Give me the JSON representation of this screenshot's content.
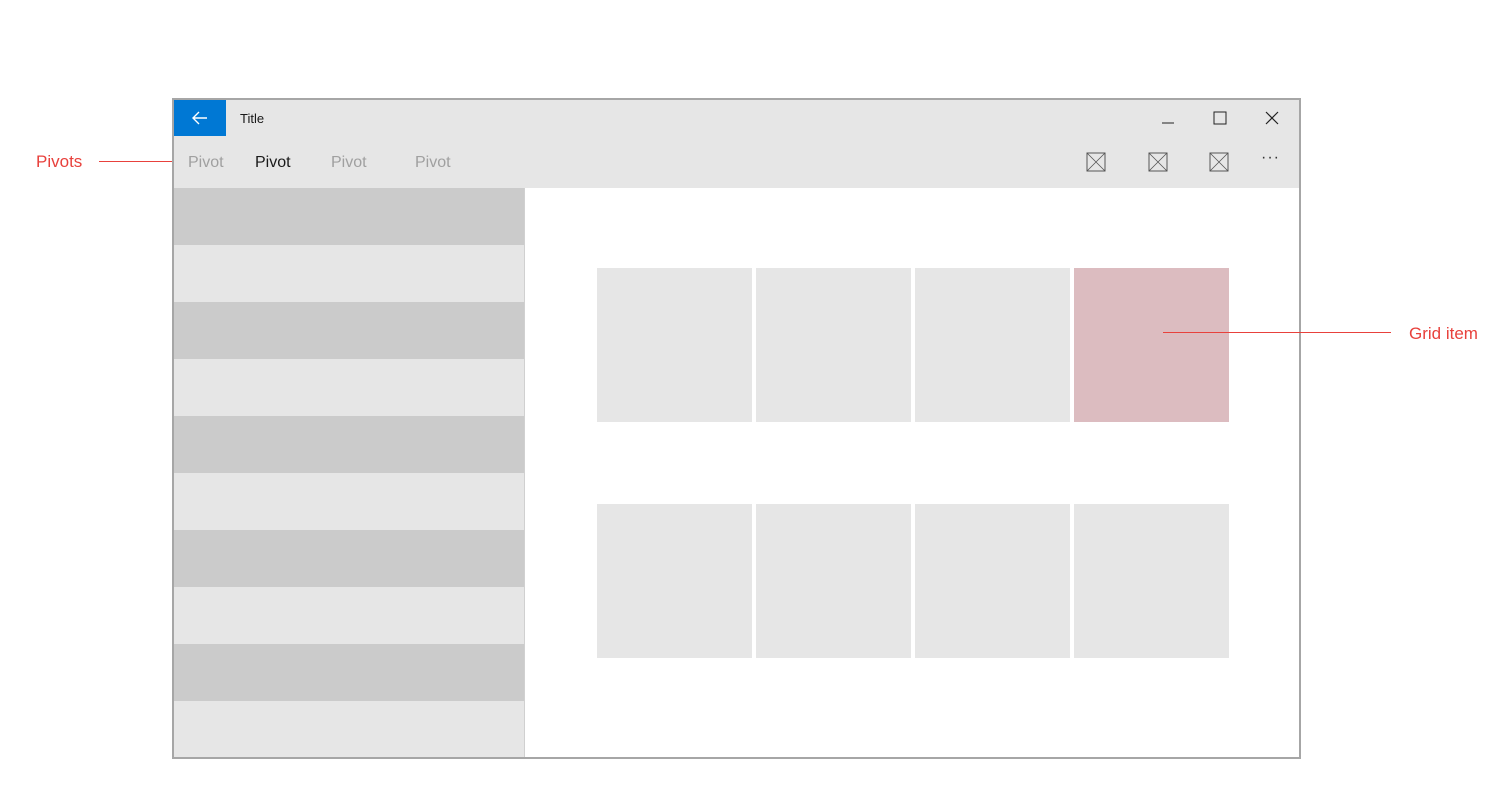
{
  "annotations": {
    "pivots": "Pivots",
    "grid_item": "Grid item"
  },
  "window": {
    "title": "Title",
    "accent_color": "#0078d4",
    "icons": {
      "back": "back-arrow-icon",
      "minimize": "minimize-icon",
      "maximize": "maximize-icon",
      "close": "close-icon"
    }
  },
  "pivots": [
    {
      "label": "Pivot",
      "selected": false
    },
    {
      "label": "Pivot",
      "selected": true
    },
    {
      "label": "Pivot",
      "selected": false
    },
    {
      "label": "Pivot",
      "selected": false
    }
  ],
  "commands": {
    "icons": [
      "placeholder-icon",
      "placeholder-icon",
      "placeholder-icon"
    ],
    "more_label": "···"
  },
  "list": {
    "row_count": 10,
    "alternating_colors": [
      "#cbcbcb",
      "#e6e6e6"
    ]
  },
  "grid": {
    "rows": 2,
    "columns": 4,
    "highlight_color": "#dcbcc0",
    "highlighted_item": {
      "row": 1,
      "column": 4
    }
  }
}
